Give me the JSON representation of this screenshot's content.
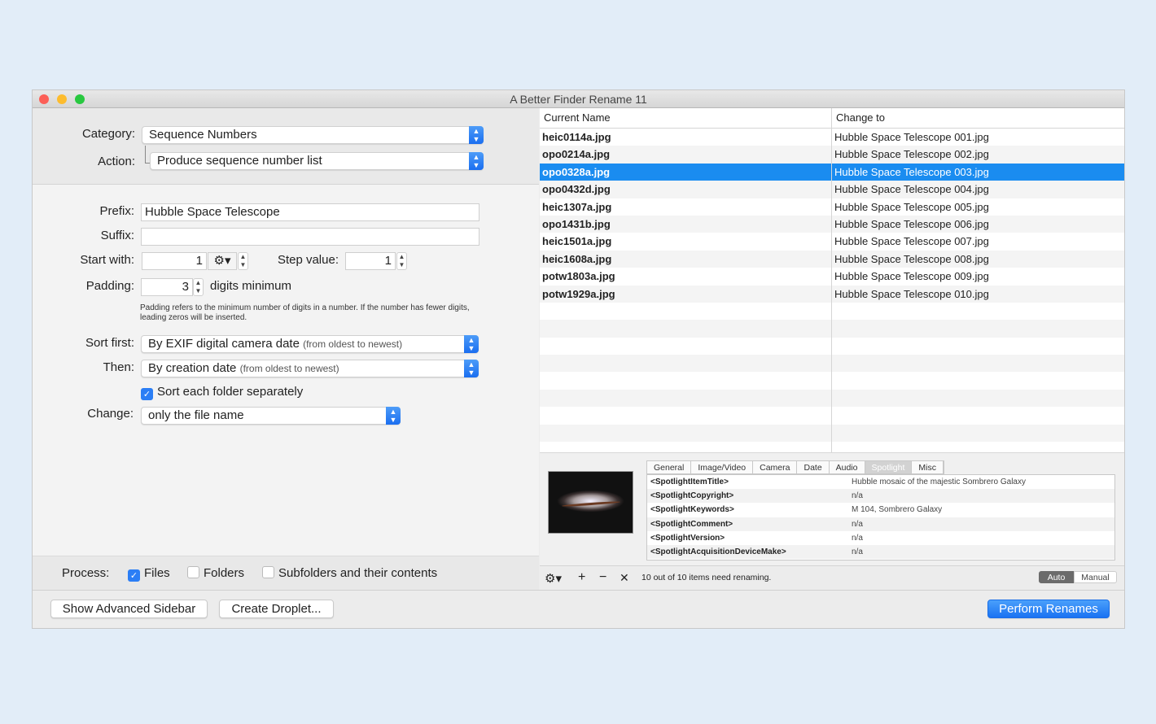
{
  "window": {
    "title": "A Better Finder Rename 11"
  },
  "header": {
    "category_label": "Category:",
    "category_value": "Sequence Numbers",
    "action_label": "Action:",
    "action_value": "Produce sequence number list"
  },
  "form": {
    "prefix_label": "Prefix:",
    "prefix_value": "Hubble Space Telescope",
    "suffix_label": "Suffix:",
    "suffix_value": "",
    "start_label": "Start with:",
    "start_value": "1",
    "step_label": "Step value:",
    "step_value": "1",
    "padding_label": "Padding:",
    "padding_value": "3",
    "padding_suffix": "digits minimum",
    "padding_help": "Padding refers to the minimum number of digits in a number. If the number has fewer digits, leading zeros will be inserted.",
    "sort_label": "Sort first:",
    "sort_value": "By EXIF digital camera date",
    "sort_note": "(from oldest to newest)",
    "then_label": "Then:",
    "then_value": "By creation date",
    "then_note": "(from oldest to newest)",
    "sort_folder_label": "Sort each folder separately",
    "sort_folder_checked": true,
    "change_label": "Change:",
    "change_value": "only the file name"
  },
  "process": {
    "label": "Process:",
    "files": "Files",
    "files_checked": true,
    "folders": "Folders",
    "folders_checked": false,
    "subfolders": "Subfolders and their contents",
    "subfolders_checked": false
  },
  "buttons": {
    "advanced": "Show Advanced Sidebar",
    "droplet": "Create Droplet...",
    "perform": "Perform Renames"
  },
  "table": {
    "headers": [
      "Current Name",
      "Change to"
    ],
    "selected_index": 2,
    "rows": [
      {
        "current": "heic0114a.jpg",
        "new": "Hubble Space Telescope 001.jpg"
      },
      {
        "current": "opo0214a.jpg",
        "new": "Hubble Space Telescope 002.jpg"
      },
      {
        "current": "opo0328a.jpg",
        "new": "Hubble Space Telescope 003.jpg"
      },
      {
        "current": "opo0432d.jpg",
        "new": "Hubble Space Telescope 004.jpg"
      },
      {
        "current": "heic1307a.jpg",
        "new": "Hubble Space Telescope 005.jpg"
      },
      {
        "current": "opo1431b.jpg",
        "new": "Hubble Space Telescope 006.jpg"
      },
      {
        "current": "heic1501a.jpg",
        "new": "Hubble Space Telescope 007.jpg"
      },
      {
        "current": "heic1608a.jpg",
        "new": "Hubble Space Telescope 008.jpg"
      },
      {
        "current": "potw1803a.jpg",
        "new": "Hubble Space Telescope 009.jpg"
      },
      {
        "current": "potw1929a.jpg",
        "new": "Hubble Space Telescope 010.jpg"
      }
    ]
  },
  "info": {
    "tabs": [
      "General",
      "Image/Video",
      "Camera",
      "Date",
      "Audio",
      "Spotlight",
      "Misc"
    ],
    "active_tab": "Spotlight",
    "rows": [
      {
        "key": "<SpotlightItemTitle>",
        "value": "Hubble mosaic of the majestic Sombrero Galaxy"
      },
      {
        "key": "<SpotlightCopyright>",
        "value": "n/a"
      },
      {
        "key": "<SpotlightKeywords>",
        "value": "M 104, Sombrero Galaxy"
      },
      {
        "key": "<SpotlightComment>",
        "value": "n/a"
      },
      {
        "key": "<SpotlightVersion>",
        "value": "n/a"
      },
      {
        "key": "<SpotlightAcquisitionDeviceMake>",
        "value": "n/a"
      }
    ]
  },
  "toolbar": {
    "gear": "⚙▾",
    "add": "+",
    "remove": "−",
    "clear": "✕",
    "status": "10 out of 10 items need renaming.",
    "auto": "Auto",
    "manual": "Manual"
  }
}
